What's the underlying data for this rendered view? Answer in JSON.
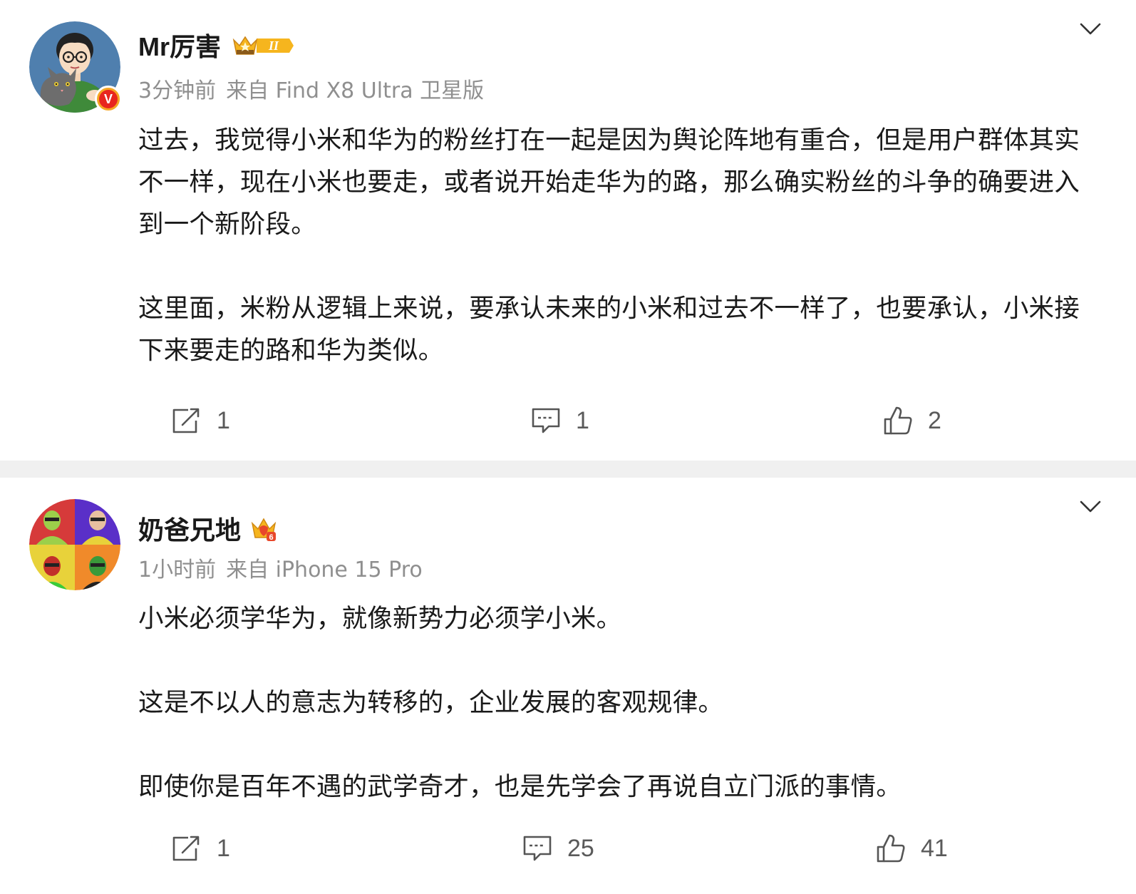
{
  "posts": [
    {
      "username": "Mr厉害",
      "time": "3分钟前",
      "source": "来自 Find X8 Ultra 卫星版",
      "level_badge": "II",
      "avatar_badge": "V",
      "paragraphs": [
        "过去，我觉得小米和华为的粉丝打在一起是因为舆论阵地有重合，但是用户群体其实不一样，现在小米也要走，或者说开始走华为的路，那么确实粉丝的斗争的确要进入到一个新阶段。",
        "这里面，米粉从逻辑上来说，要承认未来的小米和过去不一样了，也要承认，小米接下来要走的路和华为类似。"
      ],
      "repost_count": "1",
      "comment_count": "1",
      "like_count": "2"
    },
    {
      "username": "奶爸兄地",
      "time": "1小时前",
      "source": "来自 iPhone 15 Pro",
      "level_badge": "6",
      "paragraphs": [
        "小米必须学华为，就像新势力必须学小米。",
        "这是不以人的意志为转移的，企业发展的客观规律。",
        "即使你是百年不遇的武学奇才，也是先学会了再说自立门派的事情。"
      ],
      "repost_count": "1",
      "comment_count": "25",
      "like_count": "41"
    }
  ],
  "icons": {
    "more": "chevron-down-icon",
    "repost": "share-icon",
    "comment": "comment-icon",
    "like": "thumbs-up-icon"
  },
  "colors": {
    "text": "#1a1a1a",
    "meta": "#8f8f8f",
    "action": "#5a5a5a",
    "divider": "#f0f0f0",
    "verified_red": "#e8261e",
    "verified_gold": "#f5a623"
  }
}
